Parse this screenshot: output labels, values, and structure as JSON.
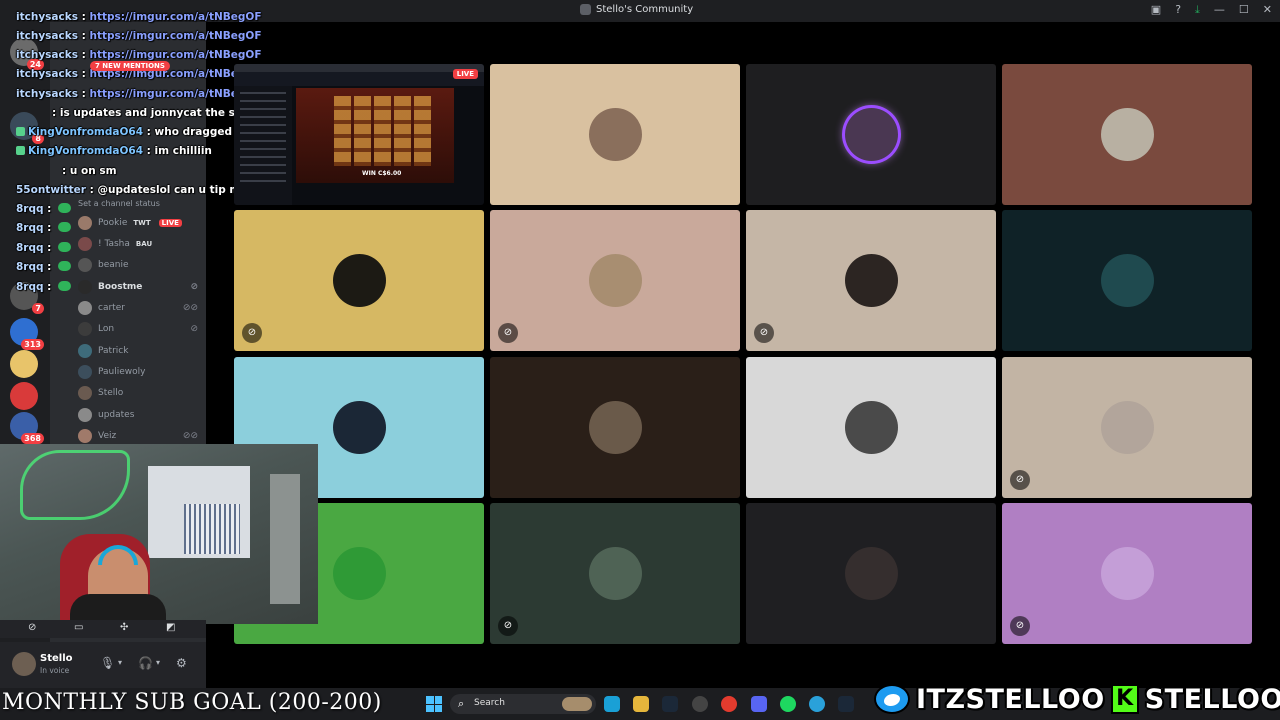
{
  "window": {
    "title": "Stello's Community",
    "controls": [
      "screen-share-icon",
      "help-icon",
      "download-icon",
      "minimize-icon",
      "maximize-icon",
      "close-icon"
    ]
  },
  "server_badges": [
    "24",
    "8",
    "7",
    "313",
    "368"
  ],
  "new_mentions": "7 NEW MENTIONS",
  "channel_status_placeholder": "Set a channel status",
  "members": [
    {
      "name": "Pookie",
      "tag": "TWT",
      "live": "LIVE"
    },
    {
      "name": "! Tasha",
      "tag": "BAU"
    },
    {
      "name": "beanie"
    },
    {
      "name": "Boostme"
    },
    {
      "name": "carter"
    },
    {
      "name": "Lon"
    },
    {
      "name": "Patrick"
    },
    {
      "name": "Pauliewoly"
    },
    {
      "name": "Stello"
    },
    {
      "name": "updates"
    },
    {
      "name": "Veiz"
    }
  ],
  "chat": [
    {
      "user": "itchysacks",
      "text": "https://imgur.com/a/tNBegOF"
    },
    {
      "user": "itchysacks",
      "text": "https://imgur.com/a/tNBegOF"
    },
    {
      "user": "itchysacks",
      "text": "https://imgur.com/a/tNBegOF"
    },
    {
      "user": "itchysacks",
      "text": "https://imgur.com/a/tNBegOF"
    },
    {
      "user": "itchysacks",
      "text": "https://imgur.com/a/tNBegOF"
    },
    {
      "user": "",
      "text": "is updates and jonnycat the same person or am i on sm"
    },
    {
      "user": "KingVonfromdaO64",
      "text": "who dragged me"
    },
    {
      "user": "KingVonfromdaO64",
      "text": "im chilliin"
    },
    {
      "user": "",
      "text": "u on sm"
    },
    {
      "user": "55ontwitter",
      "text": "@updateslol can u tip me?"
    },
    {
      "user": "8rqq",
      "text": ""
    },
    {
      "user": "8rqq",
      "text": ""
    },
    {
      "user": "8rqq",
      "text": ""
    },
    {
      "user": "8rqq",
      "text": ""
    },
    {
      "user": "8rqq",
      "text": ""
    }
  ],
  "stream_tile": {
    "live_label": "LIVE",
    "game_win": "WIN C$6.00"
  },
  "tiles": [
    {
      "bg": "#d9c1a0",
      "pfp": "#8a6f5c",
      "muted": false
    },
    {
      "bg": "#1e1e20",
      "pfp": "#4a3752",
      "muted": false,
      "speaking": true
    },
    {
      "bg": "#7a4a3e",
      "pfp": "#b8b0a2",
      "muted": false
    },
    {
      "bg": "#d6b863",
      "pfp": "#1c1a14",
      "muted": true
    },
    {
      "bg": "#c9a99b",
      "pfp": "#a88e71",
      "muted": true
    },
    {
      "bg": "#c5b6a6",
      "pfp": "#2c2522",
      "muted": true
    },
    {
      "bg": "#0f2227",
      "pfp": "#1f4a4f",
      "muted": false
    },
    {
      "bg": "#8ccfdc",
      "pfp": "#1b2736",
      "muted": false
    },
    {
      "bg": "#2a1f18",
      "pfp": "#6a5a4a",
      "muted": false
    },
    {
      "bg": "#d8d8d8",
      "pfp": "#4a4a4a",
      "muted": false
    },
    {
      "bg": "#c2b4a4",
      "pfp": "#b2a59b",
      "muted": true
    },
    {
      "bg": "#4aa842",
      "pfp": "#2f9a36",
      "muted": false
    },
    {
      "bg": "#2c3a33",
      "pfp": "#4f6355",
      "muted": true
    },
    {
      "bg": "#1f1f22",
      "pfp": "#352e2e",
      "muted": false
    },
    {
      "bg": "#b07fc3",
      "pfp": "#c49ed7",
      "muted": true
    }
  ],
  "user_panel": {
    "name": "Stello",
    "status": "In voice"
  },
  "overlay": {
    "sub_goal": "MONTHLY SUB GOAL (200-200)",
    "twitter": "ITZSTELLOO",
    "kick": "STELLOOO",
    "kick_letter": "K"
  },
  "taskbar": {
    "search_placeholder": "Search"
  }
}
